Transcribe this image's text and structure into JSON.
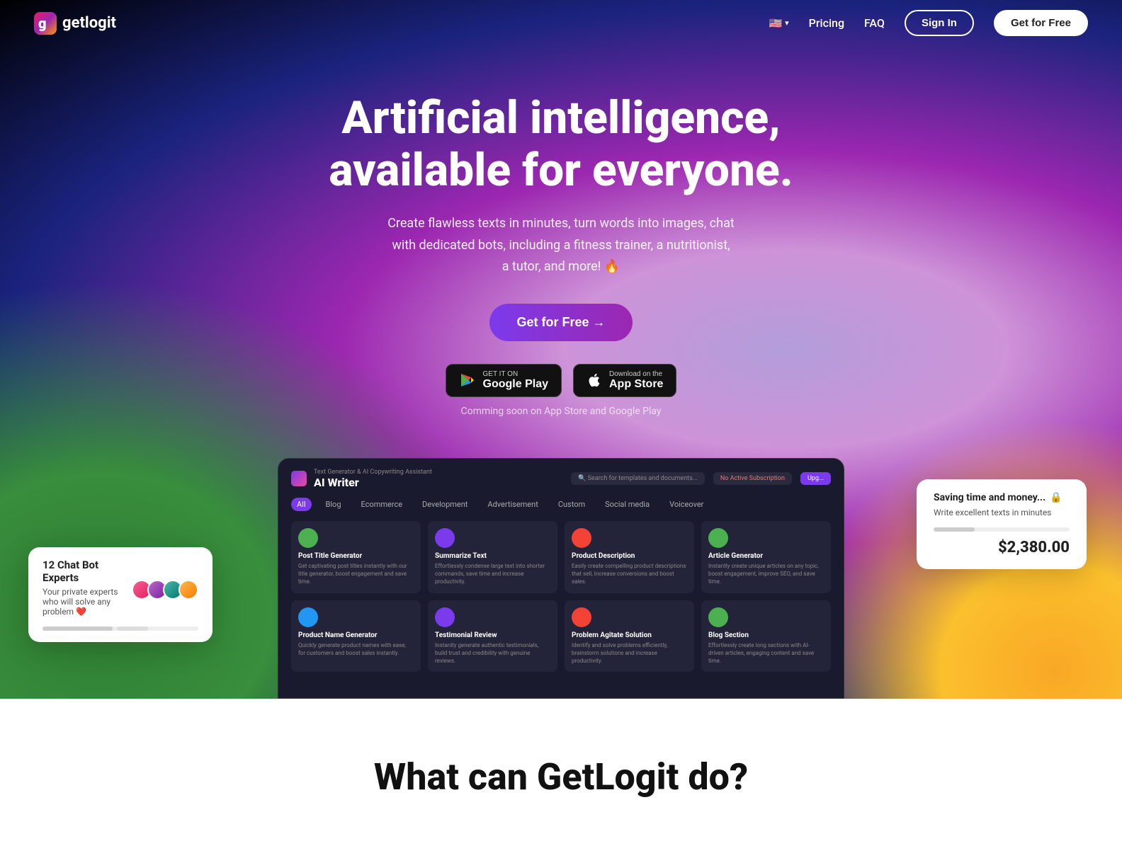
{
  "nav": {
    "logo_text": "getlogit",
    "pricing_label": "Pricing",
    "faq_label": "FAQ",
    "signin_label": "Sign In",
    "getfree_label": "Get for Free",
    "flag_emoji": "🇺🇸"
  },
  "hero": {
    "title_line1": "Artificial intelligence,",
    "title_line2": "available for everyone.",
    "subtitle": "Create flawless texts in minutes, turn words into images, chat\nwith dedicated bots, including a fitness trainer, a nutritionist,\na tutor, and more! 🔥",
    "cta_label": "Get for Free →",
    "google_play_sub": "GET IT ON",
    "google_play_name": "Google Play",
    "app_store_sub": "Download on the",
    "app_store_name": "App Store",
    "coming_soon": "Comming soon on App Store and Google Play"
  },
  "app": {
    "title": "AI Writer",
    "sub": "Text Generator & AI Copywriting Assistant",
    "search_placeholder": "Search for templates and documents...",
    "subscription_label": "No Active Subscription",
    "tabs": [
      "All",
      "Blog",
      "Ecommerce",
      "Development",
      "Advertisement",
      "Custom",
      "Social media",
      "Voiceover"
    ],
    "cards": [
      {
        "title": "Post Title Generator",
        "desc": "Get captivating post titles instantly with our title generator, boost engagement and save time.",
        "color": "#4caf50"
      },
      {
        "title": "Summarize Text",
        "desc": "Effortlessly condense large text into shorter commands, save time and increase productivity.",
        "color": "#7c3aed"
      },
      {
        "title": "Product Description",
        "desc": "Easily create compelling product descriptions that sell, increase conversions and boost sales.",
        "color": "#f44336"
      },
      {
        "title": "Article Generator",
        "desc": "Instantly create unique articles on any topic, boost engagement, improve SEO, and save time.",
        "color": "#4caf50"
      },
      {
        "title": "Product Name Generator",
        "desc": "Quickly generate product names with ease, for customers and boost sales instantly.",
        "color": "#2196f3"
      },
      {
        "title": "Testimonial Review",
        "desc": "Instantly generate authentic testimonials, build trust and credibility with genuine reviews.",
        "color": "#7c3aed"
      },
      {
        "title": "Problem Agitate Solution",
        "desc": "Identify and solve problems efficiently, brainstorm solutions and increase productivity.",
        "color": "#f44336"
      },
      {
        "title": "Blog Section",
        "desc": "Effortlessly create long sections with AI-driven articles, engaging content and save time.",
        "color": "#4caf50"
      }
    ]
  },
  "floating_right": {
    "title": "Saving time and money...",
    "icon": "🔒",
    "subtitle": "Write excellent texts in minutes",
    "price": "$2,380.00"
  },
  "floating_left": {
    "title": "12 Chat Bot Experts",
    "subtitle": "Your private experts who will solve any problem ❤️"
  },
  "what_section": {
    "title": "What can GetLogit do?"
  }
}
